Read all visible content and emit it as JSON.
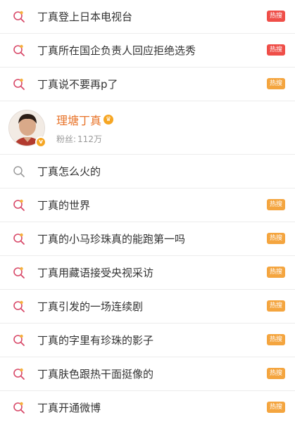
{
  "colors": {
    "hot_red": "#ef4e48",
    "hot_orange": "#f4a53f",
    "name_orange": "#e8742a"
  },
  "icons": {
    "hot_search": "search-hot-icon",
    "plain_search": "search-icon"
  },
  "top_items": [
    {
      "label": "丁真登上日本电视台",
      "badge": "热搜",
      "badge_color": "red"
    },
    {
      "label": "丁真所在国企负责人回应拒绝选秀",
      "badge": "热搜",
      "badge_color": "red"
    },
    {
      "label": "丁真说不要再p了",
      "badge": "热搜",
      "badge_color": "orange"
    }
  ],
  "user": {
    "name": "理塘丁真",
    "followers_label": "粉丝:",
    "followers_value": "112万"
  },
  "plain_item": {
    "label": "丁真怎么火的"
  },
  "bottom_items": [
    {
      "label": "丁真的世界",
      "badge": "热搜"
    },
    {
      "label": "丁真的小马珍珠真的能跑第一吗",
      "badge": "热搜"
    },
    {
      "label": "丁真用藏语接受央视采访",
      "badge": "热搜"
    },
    {
      "label": "丁真引发的一场连续剧",
      "badge": "热搜"
    },
    {
      "label": "丁真的字里有珍珠的影子",
      "badge": "热搜"
    },
    {
      "label": "丁真肤色跟热干面挺像的",
      "badge": "热搜"
    },
    {
      "label": "丁真开通微博",
      "badge": "热搜"
    }
  ]
}
